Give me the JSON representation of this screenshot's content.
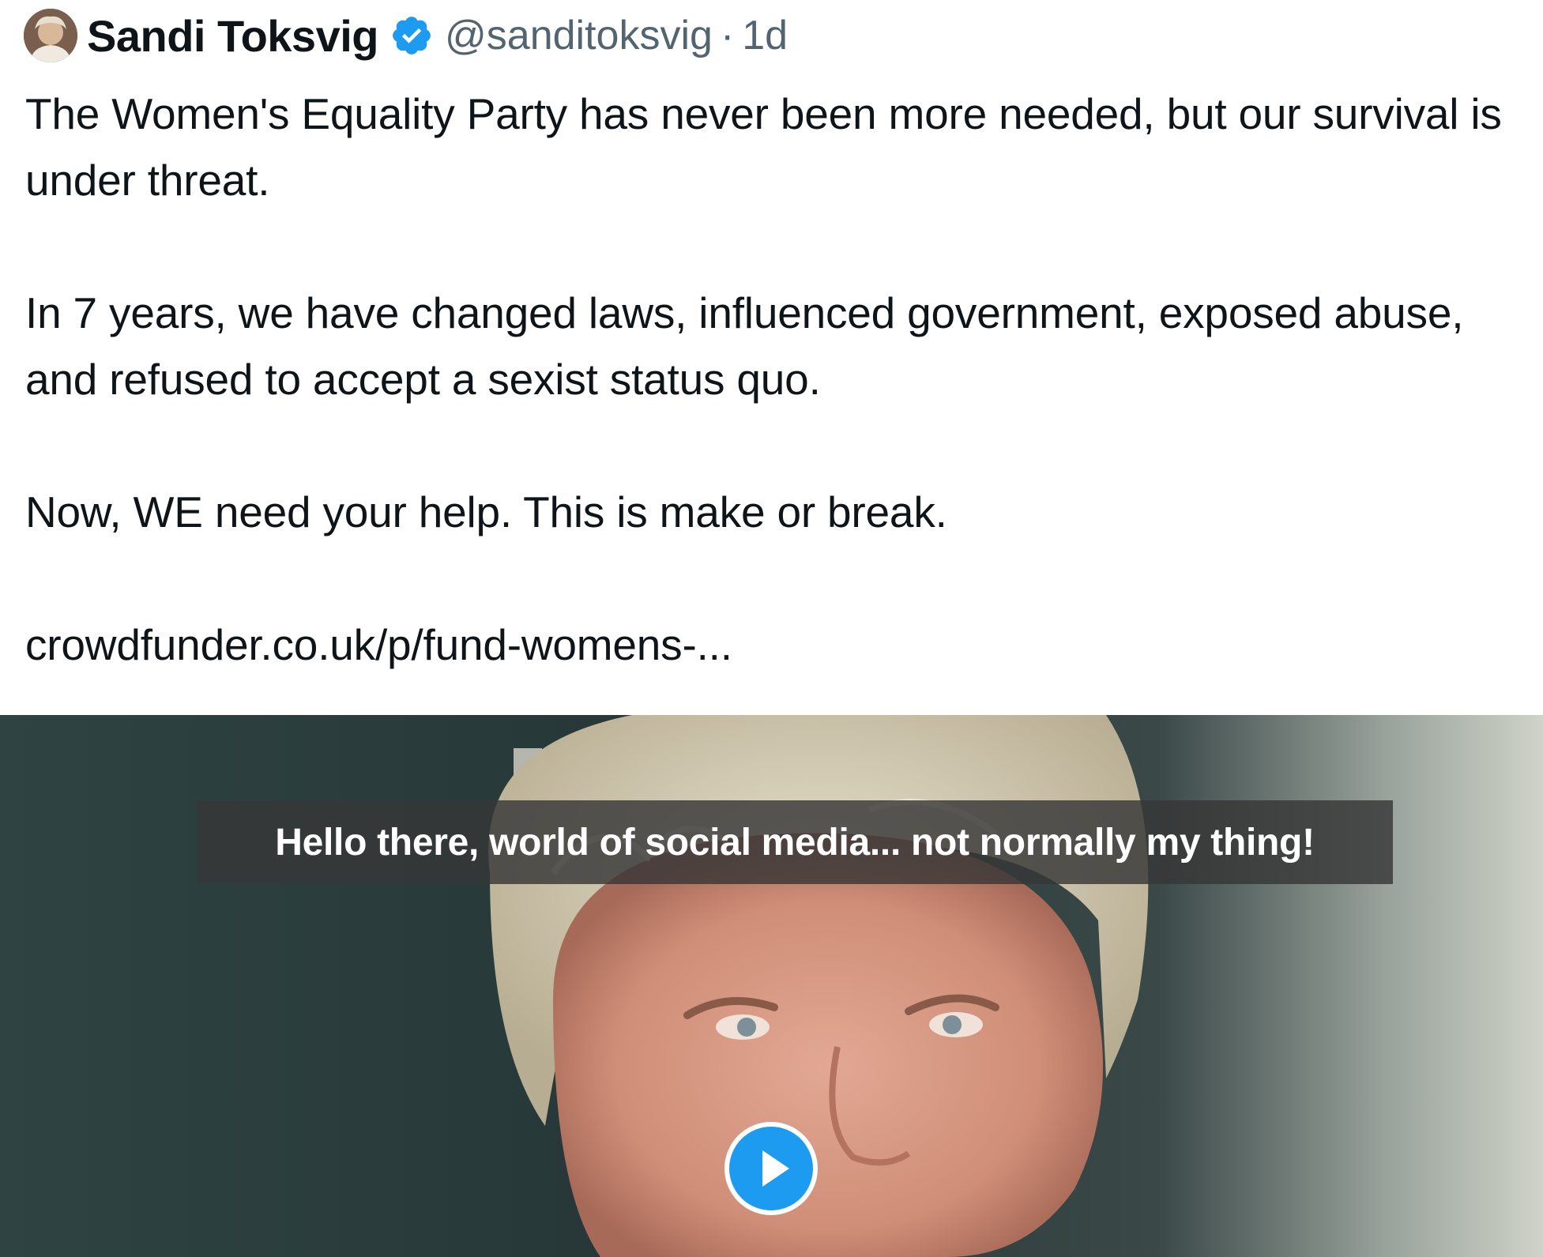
{
  "author": {
    "display_name": "Sandi Toksvig",
    "handle": "@sanditoksvig",
    "separator": "·",
    "age": "1d",
    "verified_icon": "verified-badge-icon",
    "verified_color": "#1d9bf0"
  },
  "tweet": {
    "paragraphs": [
      "The Women's Equality Party has never been more needed, but our survival is under threat.",
      "In 7 years, we have changed laws, influenced government, exposed abuse, and refused to accept a sexist status quo.",
      "Now, WE need your help. This is make or break."
    ],
    "link": "crowdfunder.co.uk/p/fund-womens-..."
  },
  "media": {
    "type": "video",
    "caption": "Hello there, world of social media... not normally my thing!",
    "play_icon": "play-icon",
    "play_color": "#1d9bf0"
  }
}
